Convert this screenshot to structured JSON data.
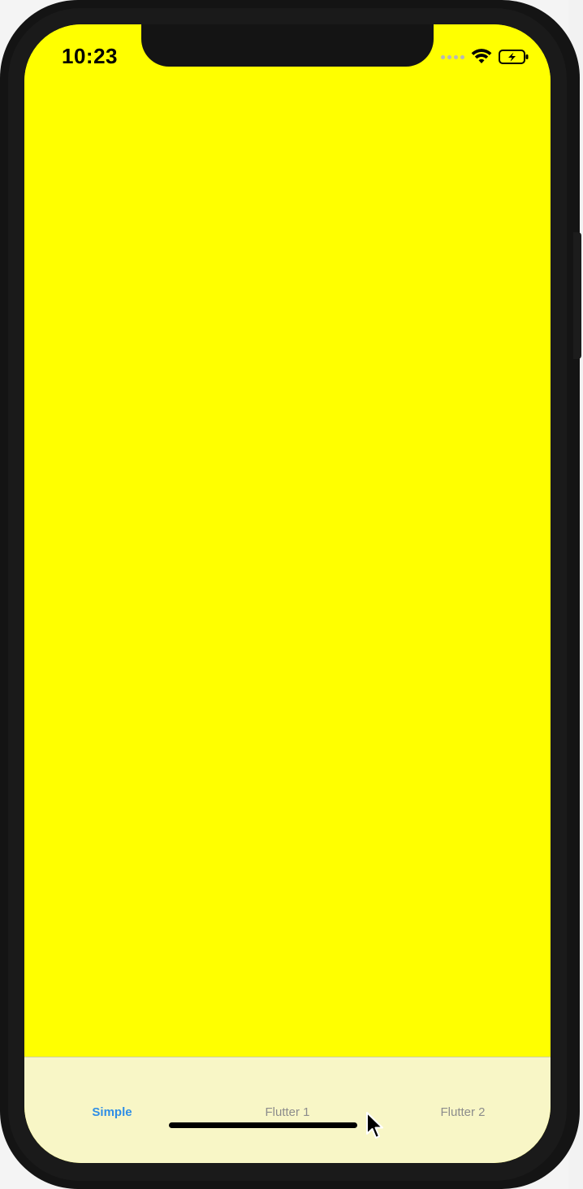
{
  "status_bar": {
    "time": "10:23",
    "icons": [
      "cellular-signal-icon",
      "wifi-icon",
      "battery-charging-icon"
    ]
  },
  "screen": {
    "background_color": "#ffff00"
  },
  "tabbar": {
    "background_color": "#f8f6c6",
    "active_color": "#2f8ee6",
    "inactive_color": "#8c8c8c",
    "tabs": [
      {
        "label": "Simple",
        "active": true
      },
      {
        "label": "Flutter 1",
        "active": false
      },
      {
        "label": "Flutter 2",
        "active": false
      }
    ]
  }
}
